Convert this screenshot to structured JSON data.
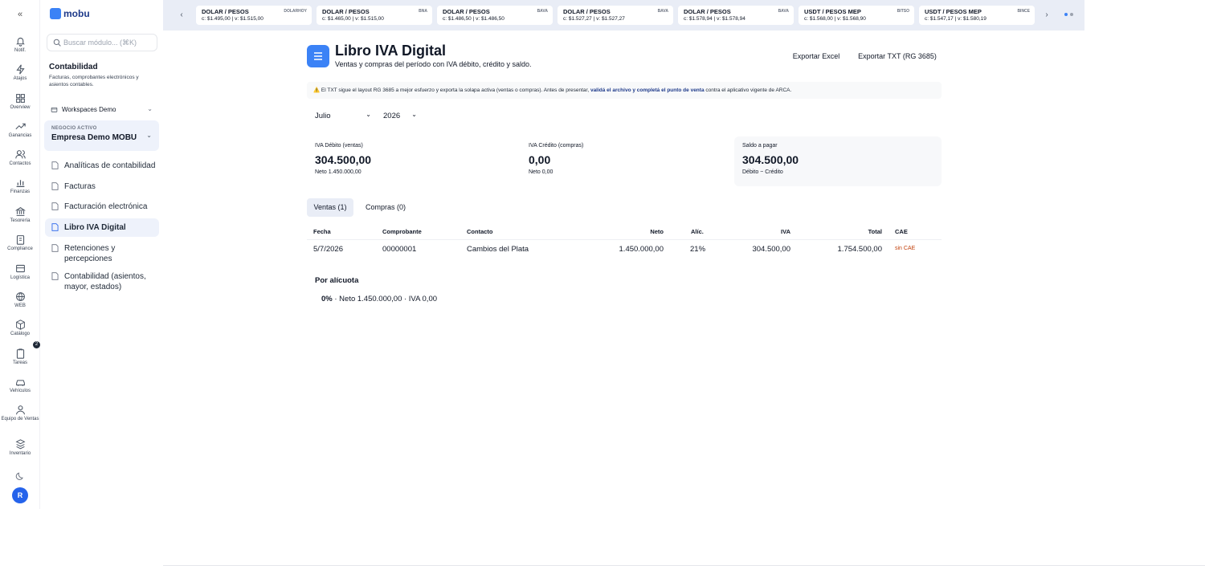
{
  "rail": {
    "collapse_label": "«",
    "items": [
      {
        "label": "Notif.",
        "icon": "bell-icon"
      },
      {
        "label": "Atajos",
        "icon": "bolt-icon"
      },
      {
        "label": "Overview",
        "icon": "grid-icon"
      },
      {
        "label": "Ganancias",
        "icon": "trend-icon"
      },
      {
        "label": "Contactos",
        "icon": "users-icon"
      },
      {
        "label": "Finanzas",
        "icon": "bar-chart-icon"
      },
      {
        "label": "Tesorería",
        "icon": "bank-icon"
      },
      {
        "label": "Compliance",
        "icon": "clipboard-icon"
      },
      {
        "label": "Logística",
        "icon": "box-icon"
      },
      {
        "label": "WEB",
        "icon": "globe-icon"
      },
      {
        "label": "Catálogo",
        "icon": "package-icon"
      },
      {
        "label": "Tareas",
        "icon": "task-icon"
      },
      {
        "label": "Vehículos",
        "icon": "car-icon"
      },
      {
        "label": "Equipo de Ventas",
        "icon": "team-icon"
      },
      {
        "label": "Inventario",
        "icon": "stack-icon"
      }
    ],
    "tasks_badge": "2",
    "avatar_initial": "R"
  },
  "sidebar": {
    "logo": "mobu",
    "search_placeholder": "Buscar módulo... (⌘K)",
    "section_title": "Contabilidad",
    "section_subtitle": "Facturas, comprobantes electrónicos y asientos contables.",
    "workspace": "Workspaces Demo",
    "business_label": "NEGOCIO ACTIVO",
    "business_name": "Empresa Demo MOBU",
    "nav": [
      {
        "label": "Analíticas de contabilidad"
      },
      {
        "label": "Facturas"
      },
      {
        "label": "Facturación electrónica"
      },
      {
        "label": "Libro IVA Digital",
        "active": true
      },
      {
        "label": "Retenciones y percepciones"
      },
      {
        "label": "Contabilidad (asientos, mayor, estados)"
      }
    ]
  },
  "tickers": [
    {
      "name": "DOLAR / PESOS",
      "source": "DOLARHOY",
      "values": "c: $1.495,00  |  v: $1.515,00"
    },
    {
      "name": "DOLAR / PESOS",
      "source": "BNA",
      "values": "c: $1.465,00  |  v: $1.515,00"
    },
    {
      "name": "DOLAR / PESOS",
      "source": "BAVA",
      "values": "c: $1.486,50  |  v: $1.486,50"
    },
    {
      "name": "DOLAR / PESOS",
      "source": "BAVA",
      "values": "c: $1.527,27  |  v: $1.527,27"
    },
    {
      "name": "DOLAR / PESOS",
      "source": "BAVA",
      "values": "c: $1.578,94  |  v: $1.578,94"
    },
    {
      "name": "USDT / PESOS MEP",
      "source": "BITSO",
      "values": "c: $1.568,00  |  v: $1.568,90"
    },
    {
      "name": "USDT / PESOS MEP",
      "source": "BINCE",
      "values": "c: $1.547,17  |  v: $1.580,19"
    }
  ],
  "page": {
    "title": "Libro IVA Digital",
    "subtitle": "Ventas y compras del período con IVA débito, crédito y saldo.",
    "export_excel": "Exportar Excel",
    "export_txt": "Exportar TXT (RG 3685)",
    "warning_pre": "⚠️ El TXT sigue el layout RG 3685 a mejor esfuerzo y exporta la solapa activa (ventas o compras). Antes de presentar, ",
    "warning_bold": "validá el archivo y completá el punto de venta",
    "warning_post": " contra el aplicativo vigente de ARCA.",
    "month": "Julio",
    "year": "2026"
  },
  "kpis": {
    "debit": {
      "label": "IVA Débito (ventas)",
      "value": "304.500,00",
      "sub": "Neto 1.450.000,00"
    },
    "credit": {
      "label": "IVA Crédito (compras)",
      "value": "0,00",
      "sub": "Neto 0,00"
    },
    "balance": {
      "label": "Saldo a pagar",
      "value": "304.500,00",
      "sub": "Débito − Crédito"
    }
  },
  "tabs": {
    "sales": "Ventas (1)",
    "purchases": "Compras (0)"
  },
  "table": {
    "headers": {
      "date": "Fecha",
      "voucher": "Comprobante",
      "contact": "Contacto",
      "net": "Neto",
      "rate": "Alíc.",
      "iva": "IVA",
      "total": "Total",
      "cae": "CAE"
    },
    "rows": [
      {
        "date": "5/7/2026",
        "voucher": "00000001",
        "contact": "Cambios del Plata",
        "net": "1.450.000,00",
        "rate": "21%",
        "iva": "304.500,00",
        "total": "1.754.500,00",
        "cae": "sin CAE"
      }
    ]
  },
  "by_rate": {
    "title": "Por alícuota",
    "rate": "0%",
    "detail": " · Neto 1.450.000,00 · IVA 0,00"
  },
  "colors": {
    "accent": "#3b82f6",
    "ticker_bg": "#e9edf6",
    "active_nav": "#eef2fb"
  }
}
